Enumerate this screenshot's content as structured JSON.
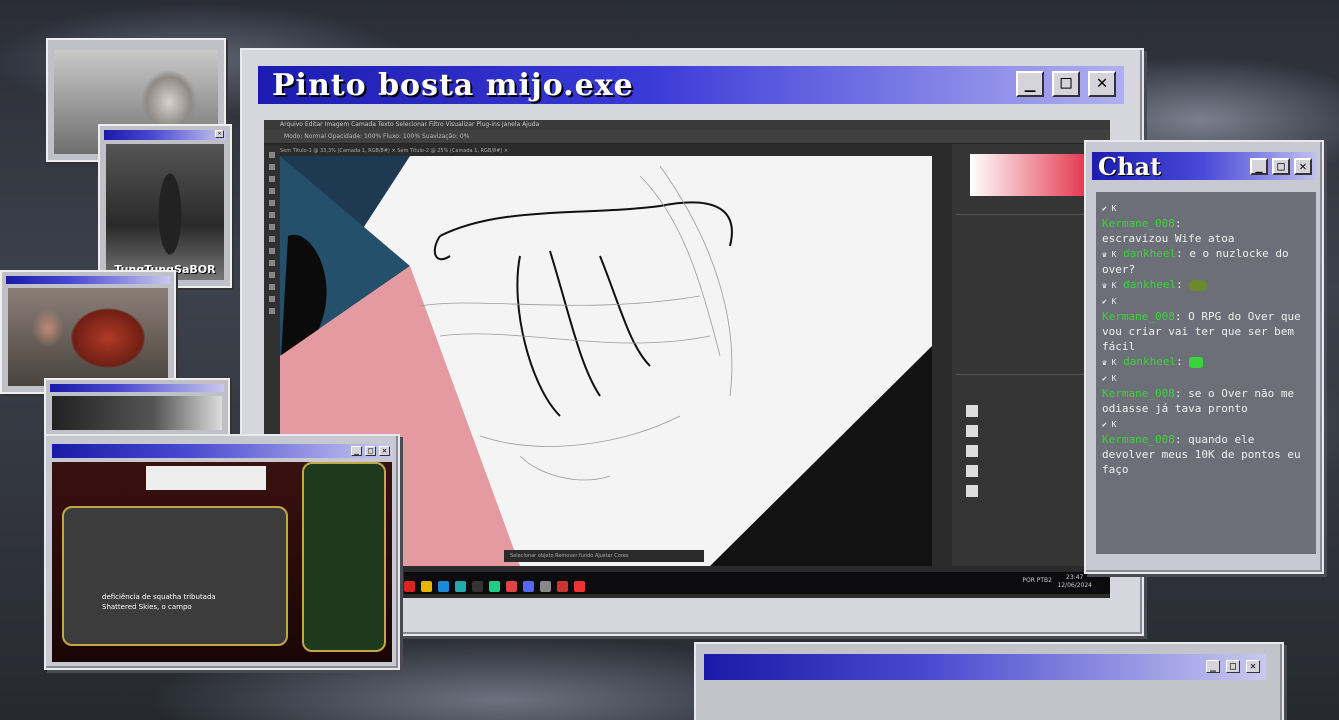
{
  "main_window": {
    "title": "Pinto bosta mijo.exe",
    "controls": [
      "_",
      "□",
      "✕"
    ]
  },
  "photoshop": {
    "menu": "Arquivo  Editar  Imagem  Camada  Texto  Selecionar  Filtro  Visualizar  Plug-ins  Janela  Ajuda",
    "options": "Modo: Normal   Opacidade: 100%   Fluxo: 100%   Suavização: 0%",
    "tabs": "Sem Título-1 @ 33,3% (Camada 1, RGB/8#)  ×    Sem Título-2 @ 25% (Camada 1, RGB/8#)  ×",
    "status": "Selecionar objeto    Remover fundo    Ajustar Cores",
    "clock_time": "23:47",
    "clock_date": "12/06/2024",
    "tray": "POR PTB2"
  },
  "chat": {
    "title": "Chat",
    "messages": [
      {
        "user": "Kermane_008",
        "text": "escravizou Wife atoa",
        "badge": "✔ K"
      },
      {
        "user": "dankheel",
        "text": "e o nuzlocke do over?",
        "badge": "♛ K"
      },
      {
        "user": "dankheel",
        "text": "",
        "badge": "♛ K"
      },
      {
        "user": "Kermane_008",
        "text": "O RPG do Over que vou criar vai ter que ser bem fácil",
        "badge": "✔ K"
      },
      {
        "user": "dankheel",
        "text": "",
        "badge": "♛ K"
      },
      {
        "user": "Kermane_008",
        "text": "se o Over não me odiasse já tava pronto",
        "badge": "✔ K"
      },
      {
        "user": "Kermane_008",
        "text": "quando ele devolver meus 10K de pontos eu faço",
        "badge": "✔ K"
      }
    ]
  },
  "webcams": {
    "cam2_caption": "TungTungSaBOR"
  },
  "game_window": {
    "caption": "deficiência de squatha tributada   Shattered Skies, o campo"
  },
  "colors": {
    "title_blue": "#1c1cb0",
    "chat_username": "#3bd33b"
  }
}
